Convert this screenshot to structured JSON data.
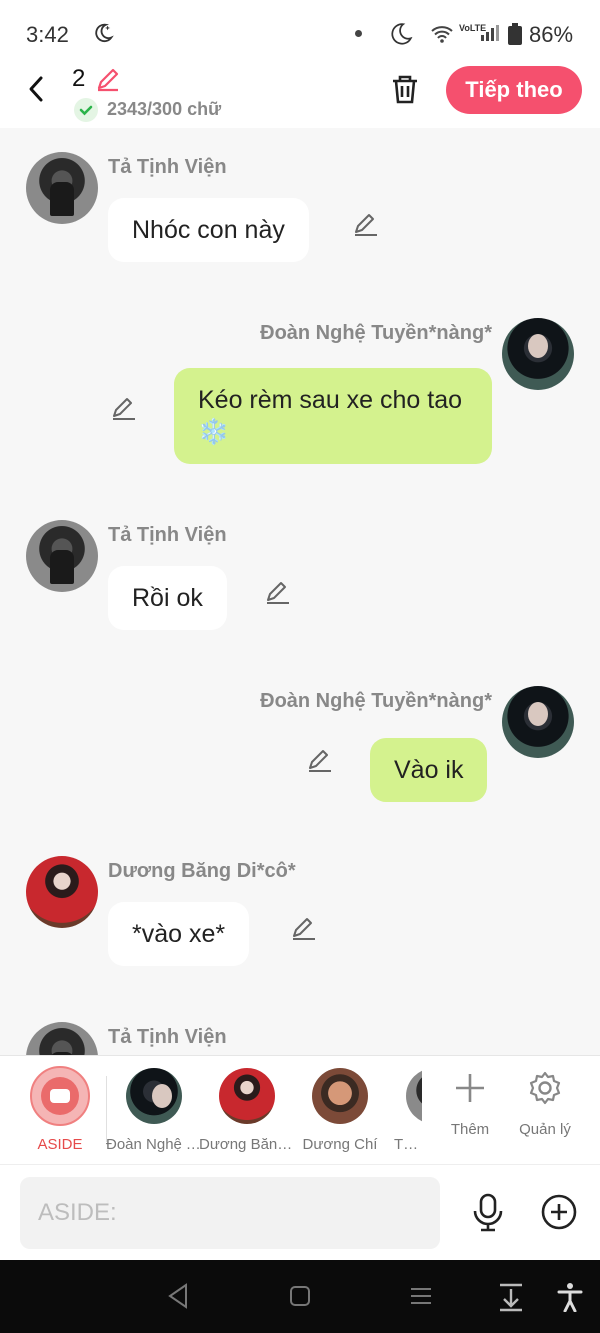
{
  "status_bar": {
    "time": "3:42",
    "network": "VoLTE",
    "battery": "86%"
  },
  "header": {
    "title": "2",
    "word_count": "2343/300 chữ",
    "next_label": "Tiếp theo",
    "accent": "#f5506e"
  },
  "messages": [
    {
      "sender": "Tả Tịnh Viện",
      "text": "Nhóc con này",
      "side": "left"
    },
    {
      "sender": "Đoàn Nghệ Tuyền*nàng*",
      "text": "Kéo rèm sau xe cho tao ❄️",
      "side": "right"
    },
    {
      "sender": "Tả Tịnh Viện",
      "text": "Rồi ok",
      "side": "left"
    },
    {
      "sender": "Đoàn Nghệ Tuyền*nàng*",
      "text": "Vào ik",
      "side": "right"
    },
    {
      "sender": "Dương Băng Di*cô*",
      "text": "*vào xe*",
      "side": "left"
    },
    {
      "sender": "Tả Tịnh Viện",
      "text": "",
      "side": "left"
    }
  ],
  "character_bar": {
    "aside_label": "ASIDE",
    "characters": [
      "Đoàn Nghệ Tuyền",
      "Dương Băng Di",
      "Dương Chí",
      "Tả T"
    ],
    "add_label": "Thêm",
    "manage_label": "Quản lý"
  },
  "input": {
    "placeholder": "ASIDE:"
  },
  "colors": {
    "bubble_right": "#d4f28e",
    "bubble_left": "#ffffff",
    "aside": "#e64a4a"
  }
}
